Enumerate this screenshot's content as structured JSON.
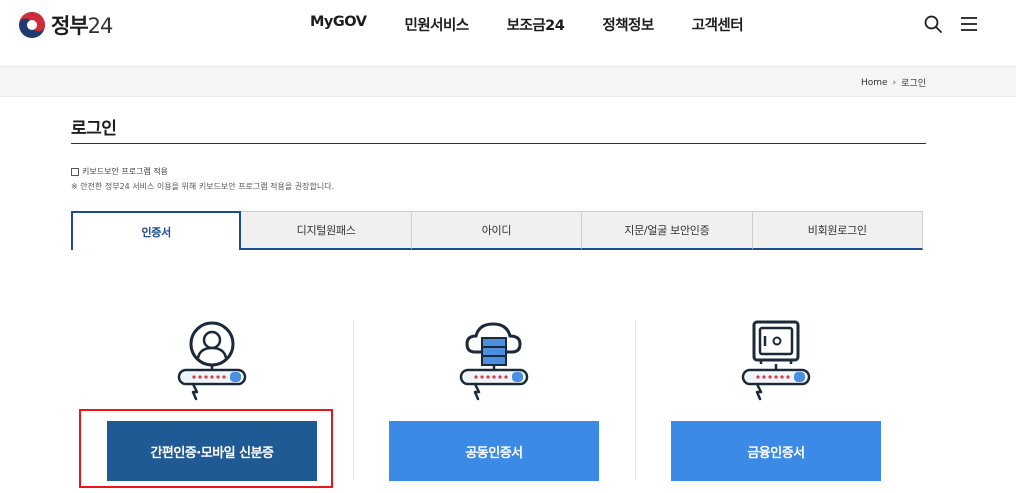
{
  "header": {
    "logo_text": "정부",
    "logo_num": "24",
    "nav": [
      "MyGOV",
      "민원서비스",
      "보조금24",
      "정책정보",
      "고객센터"
    ],
    "search_icon": "search-icon",
    "menu_icon": "hamburger-menu-icon"
  },
  "breadcrumb": {
    "home": "Home",
    "separator": "›",
    "current": "로그인"
  },
  "page": {
    "title": "로그인",
    "keyboard_security_label": "키보드보안 프로그램 적용",
    "keyboard_security_checked": false,
    "keyboard_security_note": "※ 안전한 정부24 서비스 이용을 위해 키보드보안 프로그램 적용을 권장합니다."
  },
  "tabs": [
    {
      "label": "인증서",
      "active": true
    },
    {
      "label": "디지털원패스",
      "active": false
    },
    {
      "label": "아이디",
      "active": false
    },
    {
      "label": "지문/얼굴 보안인증",
      "active": false
    },
    {
      "label": "비회원로그인",
      "active": false
    }
  ],
  "cards": [
    {
      "icon": "person-certificate-icon",
      "button": "간편인증·모바일 신분증",
      "highlighted": true
    },
    {
      "icon": "cloud-server-certificate-icon",
      "button": "공동인증서",
      "highlighted": false
    },
    {
      "icon": "safe-certificate-icon",
      "button": "금융인증서",
      "highlighted": false
    }
  ],
  "colors": {
    "primary_dark": "#1f5a94",
    "primary_light": "#3a8ae6",
    "tab_accent": "#1c4d8c",
    "highlight": "#e8171b"
  }
}
